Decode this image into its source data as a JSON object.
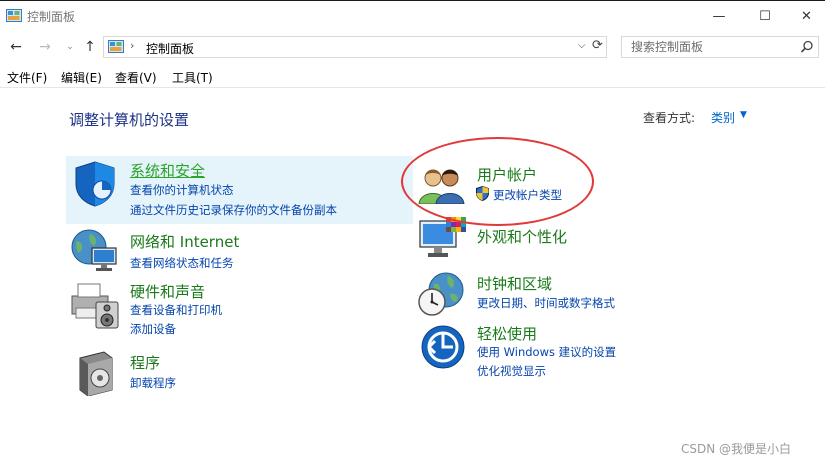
{
  "window": {
    "title": "控制面板",
    "minimize_glyph": "—",
    "maximize_glyph": "☐",
    "close_glyph": "✕"
  },
  "nav": {
    "back_glyph": "←",
    "forward_glyph": "→",
    "recent_glyph": "⌄",
    "up_glyph": "↑",
    "address_separator": "›",
    "address_path": "控制面板",
    "address_dropdown_glyph": "⌵",
    "refresh_glyph": "⟳"
  },
  "search": {
    "placeholder": "搜索控制面板"
  },
  "menu": [
    "文件(F)",
    "编辑(E)",
    "查看(V)",
    "工具(T)"
  ],
  "content": {
    "heading": "调整计算机的设置",
    "view_by_label": "查看方式:",
    "view_by_value": "类别",
    "view_by_caret": "▼"
  },
  "categories": {
    "security": {
      "title": "系统和安全",
      "links": [
        "查看你的计算机状态",
        "通过文件历史记录保存你的文件备份副本"
      ],
      "icon": "shield-icon"
    },
    "network": {
      "title": "网络和 Internet",
      "links": [
        "查看网络状态和任务"
      ],
      "icon": "network-globe-icon"
    },
    "hardware": {
      "title": "硬件和声音",
      "links": [
        "查看设备和打印机",
        "添加设备"
      ],
      "icon": "printer-speaker-icon"
    },
    "programs": {
      "title": "程序",
      "links": [
        "卸载程序"
      ],
      "icon": "program-disc-icon"
    },
    "accounts": {
      "title": "用户帐户",
      "links": [
        "更改帐户类型"
      ],
      "icon": "users-icon"
    },
    "appearance": {
      "title": "外观和个性化",
      "links": [],
      "icon": "monitor-palette-icon"
    },
    "clock": {
      "title": "时钟和区域",
      "links": [
        "更改日期、时间或数字格式"
      ],
      "icon": "clock-globe-icon"
    },
    "ease": {
      "title": "轻松使用",
      "links": [
        "使用 Windows 建议的设置",
        "优化视觉显示"
      ],
      "icon": "ease-of-access-icon"
    }
  },
  "colors": {
    "category_title": "#1a7a1a",
    "link": "#0645ad",
    "heading": "#1e3287",
    "highlight_bg": "#e5f3fb",
    "annotation_circle": "#e03a3a"
  },
  "watermark": "CSDN @我便是小白"
}
